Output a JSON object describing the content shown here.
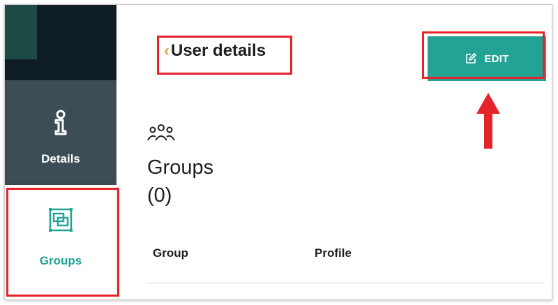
{
  "sidebar": {
    "items": [
      {
        "id": "details",
        "label": "Details",
        "icon": "info-icon",
        "active": false
      },
      {
        "id": "groups",
        "label": "Groups",
        "icon": "groups-icon",
        "active": true
      }
    ]
  },
  "header": {
    "back_label": "User details",
    "back_icon": "chevron-left-icon",
    "edit_label": "EDIT",
    "edit_icon": "pencil-edit-icon"
  },
  "groups": {
    "icon": "people-icon",
    "title": "Groups",
    "count": "(0)"
  },
  "table": {
    "columns": [
      "Group",
      "Profile"
    ]
  },
  "colors": {
    "accent": "#22a393",
    "sidebar_dark": "#0f1d24",
    "sidebar_active": "#3c4d56",
    "chevron": "#f1a33b",
    "highlight": "#e5232a"
  }
}
